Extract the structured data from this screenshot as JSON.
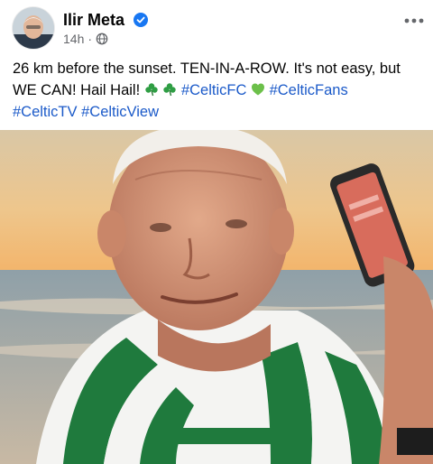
{
  "post": {
    "author": "Ilir Meta",
    "time": "14h",
    "separator": "·",
    "text": {
      "line1": "26 km before the sunset. TEN-IN-A-ROW. It's not easy, but",
      "line2_start": "WE CAN! Hail Hail!",
      "hashtag_celticfc": "#CelticFC",
      "hashtag_celticfans": "#CelticFans",
      "hashtag_celtictv": "#CelticTV",
      "hashtag_celticview": "#CelticView"
    }
  },
  "icons": {
    "verified": "verified-badge-icon",
    "audience": "globe-icon",
    "more": "more-options-icon",
    "emoji1": "shamrock-icon",
    "emoji2": "green-heart-icon"
  },
  "colors": {
    "hashtag": "#1b5ac9",
    "verified": "#1877f2",
    "secondary_text": "#65676b",
    "celtic_green": "#1f7a3d"
  }
}
